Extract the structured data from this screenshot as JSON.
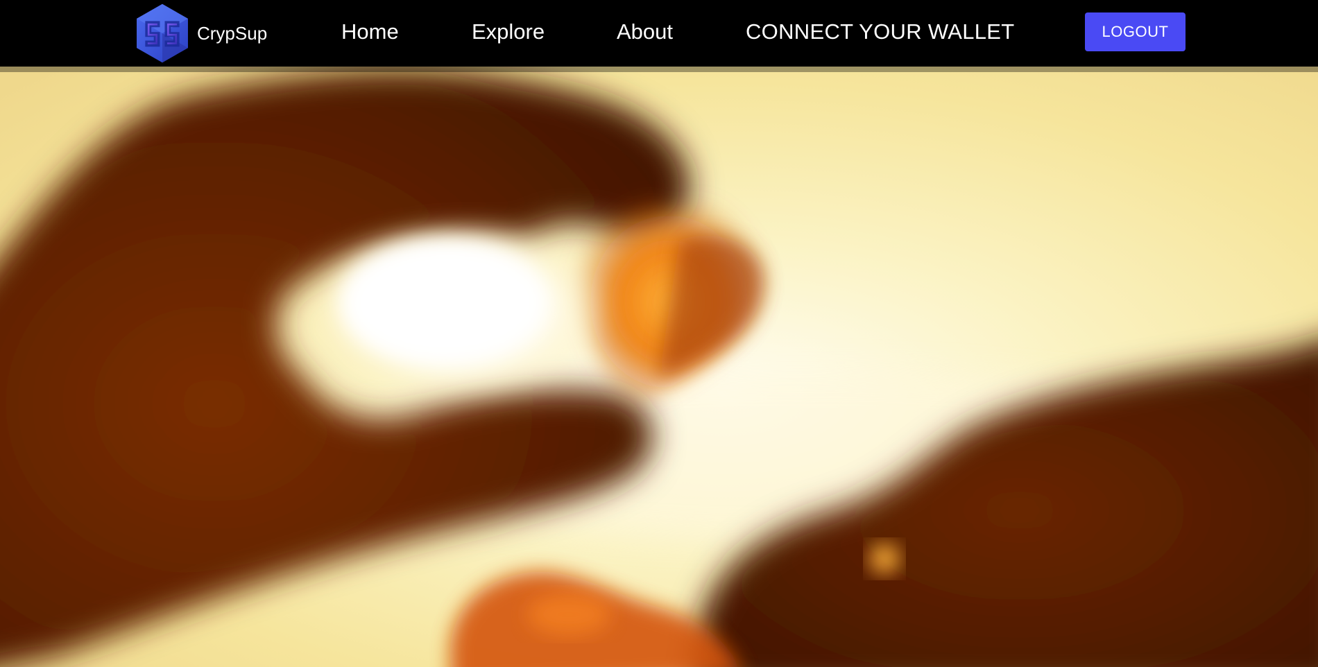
{
  "brand": {
    "name": "CrypSup",
    "logo_icon": "crypsup-logo-icon",
    "logo_color": "#3b57e0"
  },
  "nav": {
    "items": [
      {
        "label": "Home"
      },
      {
        "label": "Explore"
      },
      {
        "label": "About"
      },
      {
        "label": "CONNECT YOUR WALLET"
      }
    ],
    "logout_label": "LOGOUT"
  },
  "colors": {
    "navbar_bg": "#000000",
    "accent": "#4a4af4",
    "text": "#ffffff"
  },
  "hero": {
    "image_description_icon": "heart-hands-sunset-image",
    "blurred": true
  }
}
